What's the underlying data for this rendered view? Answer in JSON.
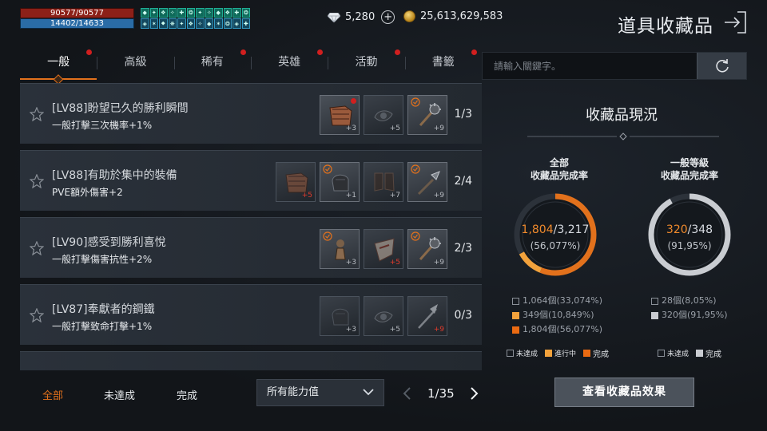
{
  "hud": {
    "hp": "90577/90577",
    "mp": "14402/14633",
    "diamonds": "5,280",
    "gold": "25,613,629,583"
  },
  "page_title": "道具收藏品",
  "tabs": [
    {
      "label": "一般",
      "dot": true,
      "active": true
    },
    {
      "label": "高級",
      "dot": false
    },
    {
      "label": "稀有",
      "dot": true
    },
    {
      "label": "英雄",
      "dot": true
    },
    {
      "label": "活動",
      "dot": true
    },
    {
      "label": "書籤",
      "dot": true
    }
  ],
  "collections": [
    {
      "title": "[LV88]盼望已久的勝利瞬間",
      "effect": "一般打擊三次機率+1%",
      "progress": "1/3",
      "items": [
        {
          "level": "+3",
          "owned": true,
          "art": "armor",
          "red_dot": true
        },
        {
          "level": "+5",
          "owned": false,
          "art": "belt"
        },
        {
          "level": "+9",
          "owned": true,
          "art": "mace",
          "check": true
        }
      ]
    },
    {
      "title": "[LV88]有助於集中的裝備",
      "effect": "PVE額外傷害+2",
      "progress": "2/4",
      "items": [
        {
          "level": "+5",
          "owned": false,
          "art": "armor",
          "red": true
        },
        {
          "level": "+1",
          "owned": true,
          "art": "glove",
          "check": true
        },
        {
          "level": "+7",
          "owned": false,
          "art": "boots"
        },
        {
          "level": "+9",
          "owned": true,
          "art": "spear",
          "check": true
        }
      ]
    },
    {
      "title": "[LV90]感受到勝利喜悅",
      "effect": "一般打擊傷害抗性+2%",
      "progress": "2/3",
      "items": [
        {
          "level": "+3",
          "owned": true,
          "art": "pawn",
          "check": true
        },
        {
          "level": "+5",
          "owned": false,
          "art": "shield",
          "red": true
        },
        {
          "level": "+9",
          "owned": true,
          "art": "mace",
          "check": true
        }
      ]
    },
    {
      "title": "[LV87]奉獻者的鋼鐵",
      "effect": "一般打擊致命打擊+1%",
      "progress": "0/3",
      "items": [
        {
          "level": "+3",
          "owned": false,
          "art": "glove"
        },
        {
          "level": "+5",
          "owned": false,
          "art": "belt"
        },
        {
          "level": "+9",
          "owned": false,
          "art": "halberd",
          "red": true
        }
      ]
    }
  ],
  "filters": {
    "all": "全部",
    "incomplete": "未達成",
    "complete": "完成"
  },
  "dropdown": "所有能力值",
  "pager": "1/35",
  "search_placeholder": "請輸入關鍵字。",
  "status": {
    "title": "收藏品現況",
    "left": {
      "label_line1": "全部",
      "label_line2": "收藏品完成率",
      "done": "1,804",
      "total": "/3,217",
      "pct": "(56,077%)",
      "legend": [
        "1,064個(33,074%)",
        "349個(10,849%)",
        "1,804個(56,077%)"
      ],
      "keys": [
        "未達成",
        "進行中",
        "完成"
      ],
      "fractions": {
        "done": 0.56077,
        "progress": 0.10849
      }
    },
    "right": {
      "label_line1": "一般等級",
      "label_line2": "收藏品完成率",
      "done": "320",
      "total": "/348",
      "pct": "(91,95%)",
      "legend": [
        "28個(8,05%)",
        "320個(91,95%)"
      ],
      "keys": [
        "未達成",
        "完成"
      ],
      "fractions": {
        "done": 0.9195
      }
    }
  },
  "effect_button": "查看收藏品效果",
  "colors": {
    "accent": "#e2711c",
    "progress": "#f2a23c",
    "badge": "#d11f1f"
  }
}
